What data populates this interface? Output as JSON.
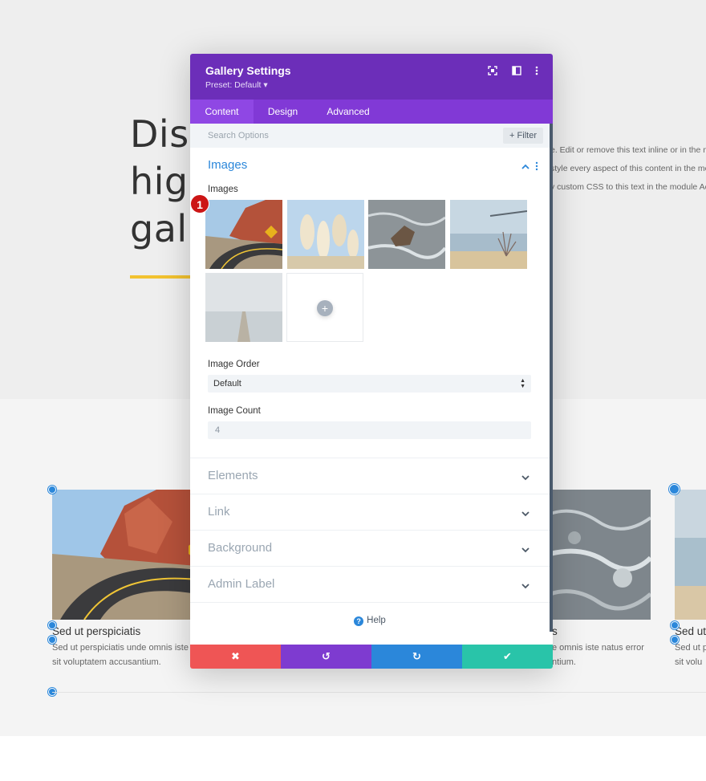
{
  "hero": {
    "heading_lines": [
      "Dis",
      "hig",
      "gal"
    ],
    "text_lines": [
      "e. Edit or remove this text inline or in the m",
      "style every aspect of this content in the mo",
      "y custom CSS to this text in the module Ac"
    ],
    "accent_color": "#f2c230"
  },
  "gallery": {
    "items": [
      {
        "caption": "Sed ut perspiciatis",
        "desc_line1": "Sed ut perspiciatis unde omnis iste",
        "desc_line2": "sit voluptatem accusantium."
      },
      {
        "caption": "s",
        "desc_line1": "e omnis iste natus error",
        "desc_line2": "ntium."
      },
      {
        "caption": "Sed ut",
        "desc_line1": "Sed ut p",
        "desc_line2": "sit volu"
      }
    ]
  },
  "modal": {
    "title": "Gallery Settings",
    "preset": "Preset: Default ▾",
    "header_icons": [
      "expand-icon",
      "sidebar-toggle-icon",
      "more-options-icon"
    ],
    "tabs": [
      {
        "label": "Content",
        "active": true
      },
      {
        "label": "Design",
        "active": false
      },
      {
        "label": "Advanced",
        "active": false
      }
    ],
    "search": {
      "placeholder": "Search Options",
      "filter_label": "Filter",
      "filter_icon": "plus-icon"
    },
    "images_section": {
      "title": "Images",
      "images_label": "Images",
      "thumbnails": [
        "desert-road",
        "pampas-grass",
        "rock-in-water",
        "dry-plant-on-beach",
        "foggy-pier"
      ],
      "add_label": "+",
      "badge": "1",
      "image_order_label": "Image Order",
      "image_order_value": "Default",
      "image_count_label": "Image Count",
      "image_count_value": "4"
    },
    "sections": [
      "Elements",
      "Link",
      "Background",
      "Admin Label"
    ],
    "help_label": "Help",
    "footer_buttons": [
      {
        "name": "cancel",
        "icon": "✖",
        "color": "#ef5555"
      },
      {
        "name": "undo",
        "icon": "↺",
        "color": "#7e3bd0"
      },
      {
        "name": "redo",
        "icon": "↻",
        "color": "#2b87da"
      },
      {
        "name": "save",
        "icon": "✔",
        "color": "#29c4a9"
      }
    ]
  }
}
